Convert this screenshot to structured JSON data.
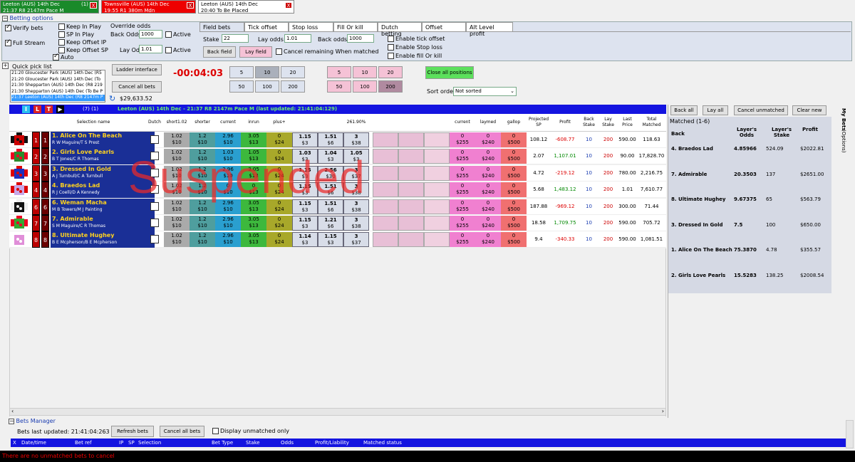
{
  "tabs": [
    {
      "line1": "Leeton (AUS) 14th Dec",
      "badge": "(1)",
      "line2": "21:37 R8 2147m Pace M"
    },
    {
      "line1": "Townsville (AUS) 14th Dec",
      "line2": "19:55 R1 380m Mdn"
    },
    {
      "line1": "Leeton (AUS) 14th Dec",
      "line2": "20:40 To Be Placed"
    }
  ],
  "close_glyph": "X",
  "betting_options": {
    "title": "Betting options",
    "verify_bets": "Verify bets",
    "full_stream": "Full Stream",
    "keep_in_play": "Keep In Play",
    "sp_in_play": "SP In Play",
    "keep_offset_ip": "Keep Offset IP",
    "keep_offset_sp": "Keep Offset SP",
    "auto": "Auto",
    "override_odds": "Override odds",
    "back_odds_label": "Back Odds",
    "back_odds_value": "1000",
    "lay_odds_label": "Lay Odds",
    "lay_odds_value": "1.01",
    "active": "Active"
  },
  "field_tabs": [
    "Field bets",
    "Tick offset",
    "Stop loss",
    "Fill Or kill",
    "Dutch betting",
    "Offset",
    "Alt Level profit"
  ],
  "field_bets": {
    "stake_label": "Stake",
    "stake_value": "22",
    "lay_odds_label": "Lay odds",
    "lay_odds_value": "1.01",
    "back_odds_label": "Back odds",
    "back_odds_value": "1000",
    "back_field": "Back field",
    "lay_field": "Lay field",
    "cancel_remaining": "Cancel remaining When matched",
    "enable_tick": "Enable tick offset",
    "enable_stop": "Enable Stop loss",
    "enable_fill": "Enable fill Or kill"
  },
  "quick_pick": {
    "title": "Quick pick list",
    "items": [
      "21:20 Gloucester Park (AUS) 14th Dec (R5",
      "21:20 Gloucester Park (AUS) 14th Dec (To",
      "21:30 Shepparton (AUS) 14th Dec (R8 219",
      "21:30 Shepparton (AUS) 14th Dec (To Be P",
      "21:37 Leeton (AUS) 14th Dec (R8 2147m P"
    ]
  },
  "ladder_btn": "Ladder interface",
  "cancel_all_btn": "Cancel all bets",
  "balance": "$29,633.52",
  "timer": "-00:04:03",
  "stake_btns_a": [
    "5",
    "10",
    "20",
    "50",
    "100",
    "200"
  ],
  "stake_btns_b": [
    "5",
    "10",
    "20",
    "50",
    "100",
    "200"
  ],
  "close_all": "Close all positions",
  "sort_label": "Sort order",
  "sort_value": "Not sorted",
  "market": {
    "controls": [
      "I",
      "L",
      "T",
      "▶"
    ],
    "count": "(7) (1)",
    "title": "Leeton (AUS) 14th Dec - 21:37 R8 2147m Pace M (last updated: 21:41:04:129)",
    "book_pct": "261.90%",
    "suspended": "Suspended"
  },
  "columns": {
    "selection": "Selection name",
    "dutch": "Dutch",
    "short": "short1.02",
    "shorter": "shorter",
    "current": "current",
    "inrun": "inrun",
    "plus": "plus+",
    "current2": "current",
    "laymed": "laymed",
    "gallop": "gallop",
    "projected_sp": "Projected SP",
    "profit": "Profit",
    "back_stake": "Back Stake",
    "lay_stake": "Lay Stake",
    "last_price": "Last Price",
    "total_matched": "Total Matched"
  },
  "runners": [
    {
      "num": "1",
      "name": "1. Alice On The Beach",
      "people": "R W Maguire/T S Prest",
      "short": "1.02",
      "shorter": "1.2",
      "current": "2.96",
      "inrun": "3.05",
      "plus": "0",
      "back": "1.15",
      "back_amt": "$3",
      "lay": "1.51",
      "lay_amt": "$6",
      "last": "3",
      "last_amt": "$38",
      "sp": "108.12",
      "profit": "-608.77",
      "bs": "10",
      "ls": "200",
      "lp": "590.00",
      "tm": "118.63",
      "silk": [
        "#c00",
        "#111"
      ]
    },
    {
      "num": "2",
      "name": "2. Girls Love Pearls",
      "people": "B T Jones/C R Thomas",
      "short": "1.02",
      "shorter": "1.2",
      "current": "1.03",
      "inrun": "1.05",
      "plus": "0",
      "back": "1.03",
      "back_amt": "$3",
      "lay": "1.04",
      "lay_amt": "$3",
      "last": "1.05",
      "last_amt": "$3",
      "sp": "2.07",
      "profit": "1,107.01",
      "bs": "10",
      "ls": "200",
      "lp": "90.00",
      "tm": "17,828.70",
      "silk": [
        "#2b8a2b",
        "#e02"
      ]
    },
    {
      "num": "3",
      "name": "3. Dressed In Gold",
      "people": "A J Turnbull/C A Turnbull",
      "short": "1.02",
      "shorter": "1.2",
      "current": "2.96",
      "inrun": "3.05",
      "plus": "0",
      "back": "1.15",
      "back_amt": "$3",
      "lay": "2.56",
      "lay_amt": "$30",
      "last": "3",
      "last_amt": "$37",
      "sp": "4.72",
      "profit": "-219.12",
      "bs": "10",
      "ls": "200",
      "lp": "780.00",
      "tm": "2,216.75",
      "silk": [
        "#1c2fbe",
        "#d00"
      ]
    },
    {
      "num": "4",
      "name": "4. Braedos Lad",
      "people": "R J Coelli/D A Kennedy",
      "short": "1.02",
      "shorter": "1.2",
      "current": "0",
      "inrun": "0",
      "plus": "0",
      "back": "1.15",
      "back_amt": "$3",
      "lay": "1.51",
      "lay_amt": "$6",
      "last": "3",
      "last_amt": "$38",
      "sp": "5.68",
      "profit": "1,483.12",
      "bs": "10",
      "ls": "200",
      "lp": "1.01",
      "tm": "7,610.77",
      "silk": [
        "#c8a8e8",
        "#d00"
      ]
    },
    {
      "num": "6",
      "name": "6. Weman Macha",
      "people": "M B Towers/M J Painting",
      "short": "1.02",
      "shorter": "1.2",
      "current": "2.96",
      "inrun": "3.05",
      "plus": "0",
      "back": "1.15",
      "back_amt": "$3",
      "lay": "1.51",
      "lay_amt": "$6",
      "last": "3",
      "last_amt": "$38",
      "sp": "187.88",
      "profit": "-969.12",
      "bs": "10",
      "ls": "200",
      "lp": "300.00",
      "tm": "71.44",
      "silk": [
        "#111",
        "#eee"
      ]
    },
    {
      "num": "7",
      "name": "7. Admirable",
      "people": "S M Maguire/C R Thomas",
      "short": "1.02",
      "shorter": "1.2",
      "current": "2.96",
      "inrun": "3.05",
      "plus": "0",
      "back": "1.15",
      "back_amt": "$3",
      "lay": "1.21",
      "lay_amt": "$6",
      "last": "3",
      "last_amt": "$38",
      "sp": "18.58",
      "profit": "1,709.75",
      "bs": "10",
      "ls": "200",
      "lp": "590.00",
      "tm": "705.72",
      "silk": [
        "#3a3",
        "#e02"
      ]
    },
    {
      "num": "8",
      "name": "8. Ultimate Hughey",
      "people": "B E Mcpherson/B E Mcpherson",
      "short": "1.02",
      "shorter": "1.2",
      "current": "2.96",
      "inrun": "3.05",
      "plus": "0",
      "back": "1.14",
      "back_amt": "$3",
      "lay": "1.15",
      "lay_amt": "$3",
      "last": "3",
      "last_amt": "$37",
      "sp": "9.4",
      "profit": "-340.33",
      "bs": "10",
      "ls": "200",
      "lp": "590.00",
      "tm": "1,081.51",
      "silk": [
        "#e08ed8",
        "#fff"
      ]
    }
  ],
  "money": {
    "m10": "$10",
    "m13": "$13",
    "m24": "$24",
    "zero": "0",
    "m255": "$255",
    "m240": "$240",
    "m500": "$500"
  },
  "right": {
    "back_all": "Back all",
    "lay_all": "Lay all",
    "cancel_unmatched": "Cancel unmatched",
    "clear_new": "Clear new",
    "matched": "Matched (1-6)",
    "my_bets": "My Bets",
    "options": "(Options)",
    "head_back": "Back",
    "head_odds": "Layer's Odds",
    "head_stake": "Layer's Stake",
    "head_profit": "Profit",
    "rows": [
      {
        "name": "4. Braedos Lad",
        "odds": "4.85966",
        "stake": "524.09",
        "profit": "$2022.81"
      },
      {
        "name": "7. Admirable",
        "odds": "20.3503",
        "stake": "137",
        "profit": "$2651.00"
      },
      {
        "name": "8. Ultimate Hughey",
        "odds": "9.67375",
        "stake": "65",
        "profit": "$563.79"
      },
      {
        "name": "3. Dressed In Gold",
        "odds": "7.5",
        "stake": "100",
        "profit": "$650.00"
      },
      {
        "name": "1. Alice On The Beach",
        "odds": "75.3870",
        "stake": "4.78",
        "profit": "$355.57"
      },
      {
        "name": "2. Girls Love Pearls",
        "odds": "15.5283",
        "stake": "138.25",
        "profit": "$2008.54"
      }
    ]
  },
  "bets_manager": {
    "title": "Bets Manager",
    "last_updated": "Bets last updated: 21:41:04:263",
    "refresh": "Refresh bets",
    "cancel_all": "Cancel all bets",
    "display_unmatched": "Display unmatched only",
    "cols": [
      "X",
      "Date/time",
      "Bet ref",
      "IP",
      "SP",
      "Selection",
      "Bet Type",
      "Stake",
      "Odds",
      "Profit/Liability",
      "Matched status"
    ],
    "status": "There are no unmatched bets to cancel"
  }
}
